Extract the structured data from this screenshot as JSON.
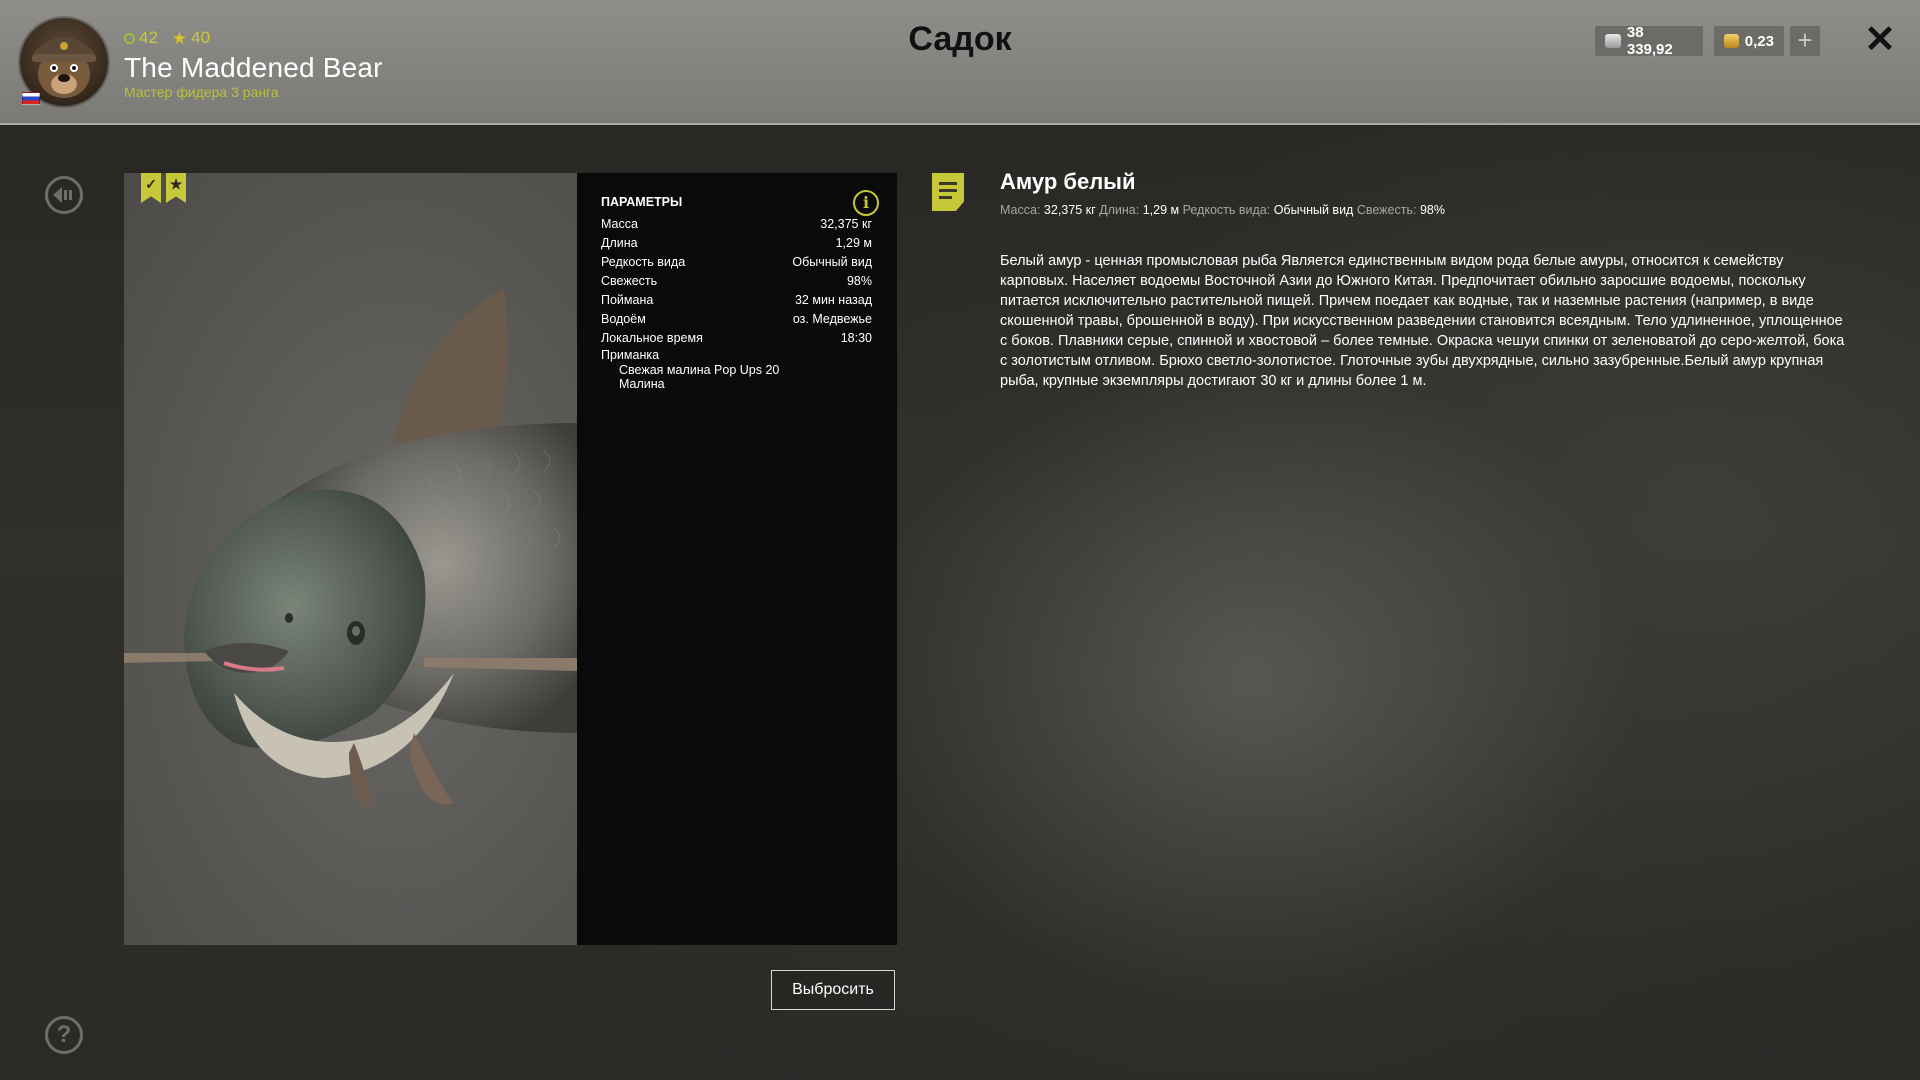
{
  "header": {
    "title": "Садок",
    "player": {
      "name": "The Maddened Bear",
      "rank": "Мастер фидера 3 ранга",
      "level": "42",
      "stars": "40"
    },
    "currency": {
      "silver": "38 339,92",
      "gold": "0,23"
    }
  },
  "params": {
    "title": "ПАРАМЕТРЫ",
    "rows": [
      {
        "label": "Масса",
        "value": "32,375 кг"
      },
      {
        "label": "Длина",
        "value": "1,29 м"
      },
      {
        "label": "Редкость вида",
        "value": "Обычный вид"
      },
      {
        "label": "Свежесть",
        "value": "98%"
      },
      {
        "label": "Поймана",
        "value": "32 мин назад"
      },
      {
        "label": "Водоём",
        "value": "оз. Медвежье"
      },
      {
        "label": "Локальное время",
        "value": "18:30"
      }
    ],
    "bait_label": "Приманка",
    "baits": [
      "Свежая малина Pop Ups 20",
      "Малина"
    ]
  },
  "actions": {
    "discard": "Выбросить"
  },
  "fish": {
    "name": "Амур белый",
    "meta": {
      "mass_label": "Масса:",
      "mass": "32,375 кг",
      "length_label": "Длина:",
      "length": "1,29 м",
      "rarity_label": "Редкость вида:",
      "rarity": "Обычный вид",
      "freshness_label": "Свежесть:",
      "freshness": "98%"
    },
    "description": "Белый амур - ценная промысловая рыба Является единственным видом рода белые амуры, относится к семейству карповых. Населяет водоемы Восточной Азии до Южного Китая. Предпочитает обильно заросшие водоемы, поскольку питается исключительно растительной пищей. Причем поедает как водные, так и наземные растения (например, в виде скошенной травы, брошенной в воду). При искусственном разведении становится всеядным. Тело удлиненное, уплощенное с боков. Плавники серые, спинной и хвостовой – более темные. Окраска чешуи спинки от зеленоватой до серо-желтой, бока с золотистым отливом. Брюхо светло-золотистое. Глоточные зубы двухрядные, сильно зазубренные.Белый амур крупная рыба, крупные экземпляры достигают 30 кг и длины более 1 м."
  },
  "icons": {
    "back": "back-arrow-icon",
    "help": "question-icon",
    "close": "close-icon",
    "info": "info-icon",
    "note": "note-icon"
  }
}
